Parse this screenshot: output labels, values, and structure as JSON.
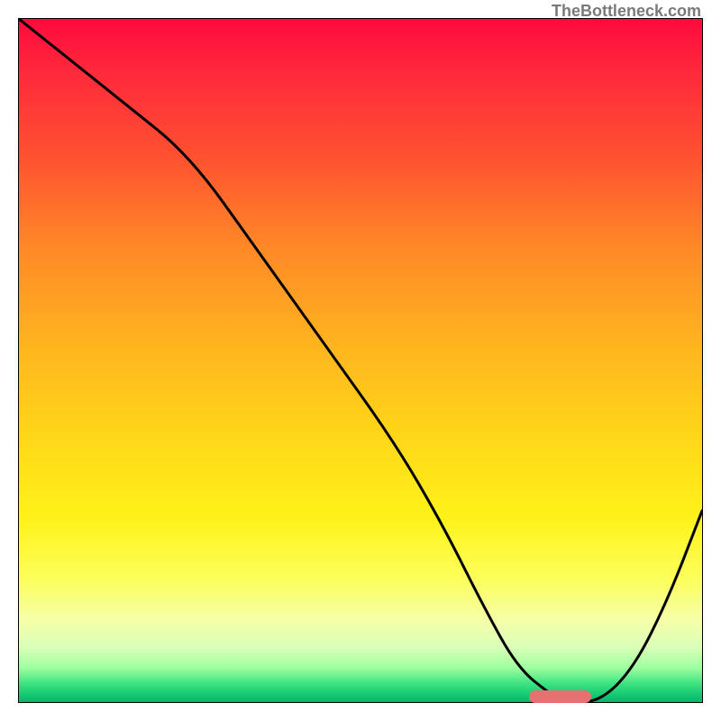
{
  "watermark": "TheBottleneck.com",
  "chart_data": {
    "type": "line",
    "title": "",
    "xlabel": "",
    "ylabel": "",
    "xlim": [
      0,
      100
    ],
    "ylim": [
      0,
      100
    ],
    "grid": false,
    "series": [
      {
        "name": "bottleneck-curve",
        "x": [
          0,
          15,
          25,
          35,
          45,
          55,
          62,
          68,
          73,
          78,
          80,
          85,
          90,
          95,
          100
        ],
        "y": [
          100,
          88,
          80,
          66,
          52,
          38,
          26,
          14,
          5,
          1,
          0,
          0,
          5,
          15,
          28
        ]
      }
    ],
    "marker": {
      "x_center": 79,
      "width_pct": 9,
      "y": 1
    },
    "gradient_scale": {
      "top_color": "#ff0a3c",
      "bottom_color": "#00b768",
      "description": "red(high)→yellow→green(low)"
    }
  }
}
